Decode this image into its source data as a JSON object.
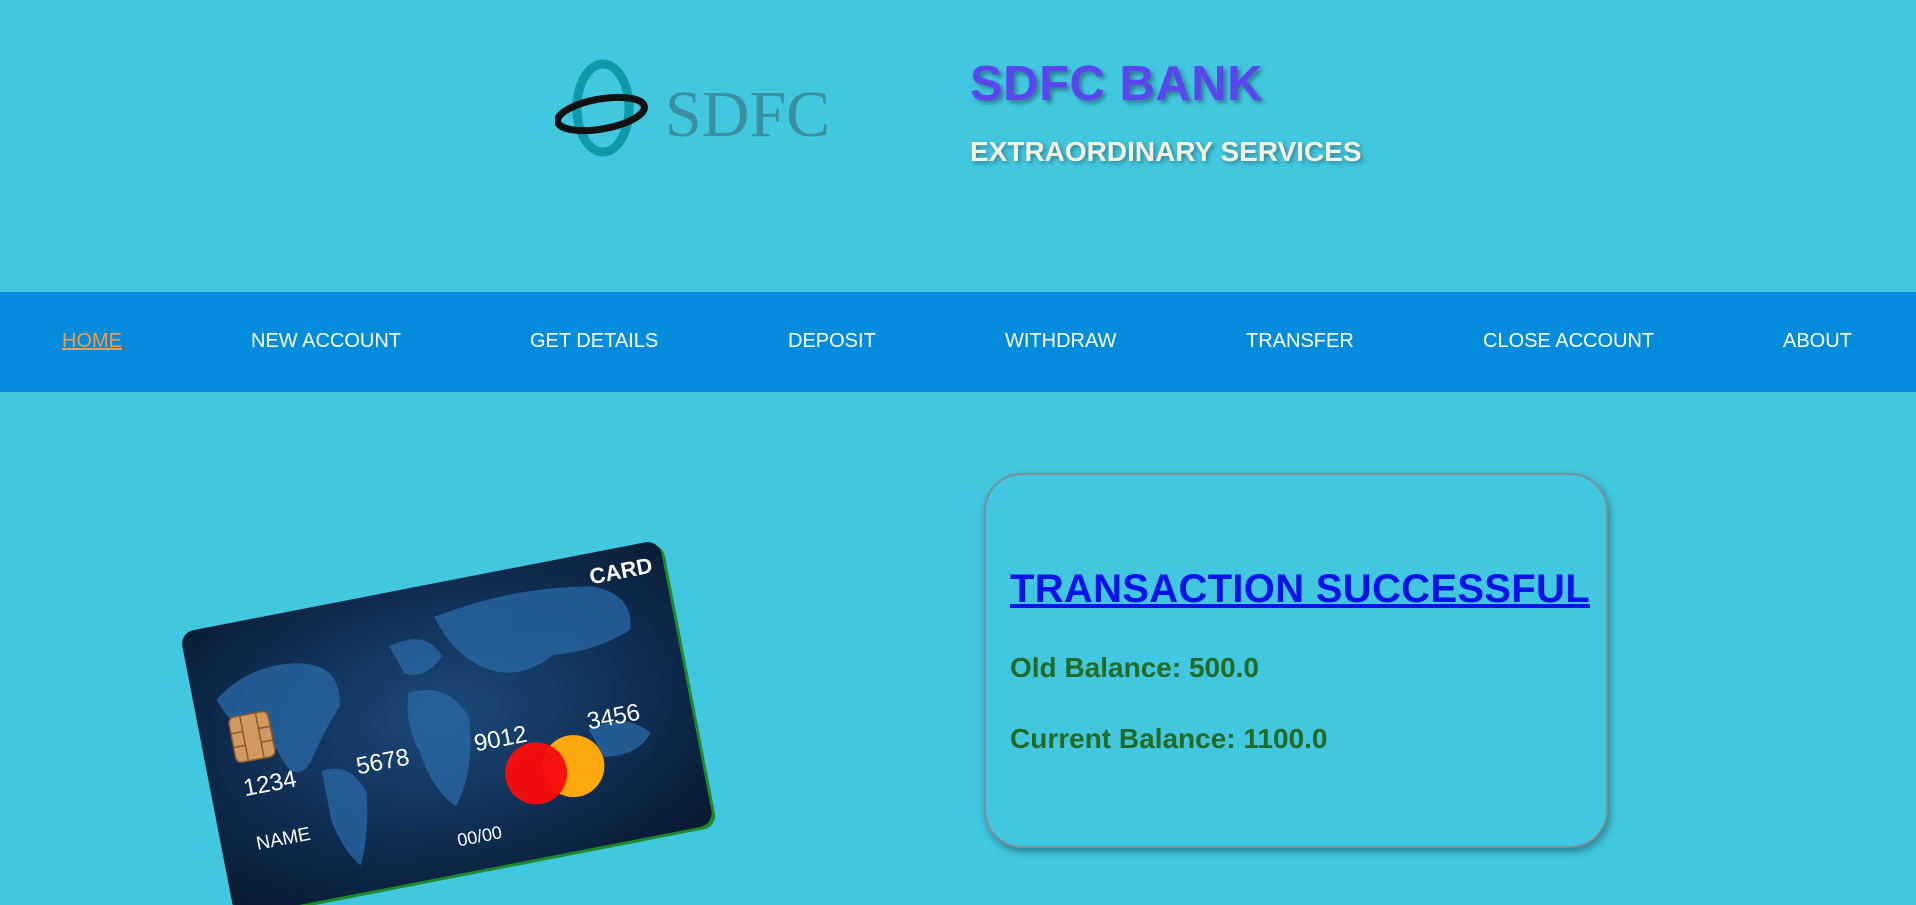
{
  "header": {
    "logo_text": "SDFC",
    "bank_name": "SDFC BANK",
    "tagline": "EXTRAORDINARY SERVICES"
  },
  "nav": {
    "items": [
      {
        "label": "HOME",
        "active": true
      },
      {
        "label": "NEW ACCOUNT",
        "active": false
      },
      {
        "label": "GET DETAILS",
        "active": false
      },
      {
        "label": "DEPOSIT",
        "active": false
      },
      {
        "label": "WITHDRAW",
        "active": false
      },
      {
        "label": "TRANSFER",
        "active": false
      },
      {
        "label": "CLOSE ACCOUNT",
        "active": false
      },
      {
        "label": "ABOUT",
        "active": false
      }
    ]
  },
  "card": {
    "brand_label": "CARD",
    "number_groups": [
      "1234",
      "5678",
      "9012",
      "3456"
    ],
    "holder_name": "NAME",
    "expiry": "00/00"
  },
  "result": {
    "title": "TRANSACTION SUCCESSFUL",
    "old_balance_label": "Old Balance: 500.0",
    "current_balance_label": "Current Balance: 1100.0"
  },
  "colors": {
    "page_background": "#42c7e0",
    "navbar": "#028cdb",
    "nav_active": "#f39b45",
    "bank_title": "#5b45ee",
    "result_title": "#0b12e8",
    "balance_text": "#226b25"
  }
}
